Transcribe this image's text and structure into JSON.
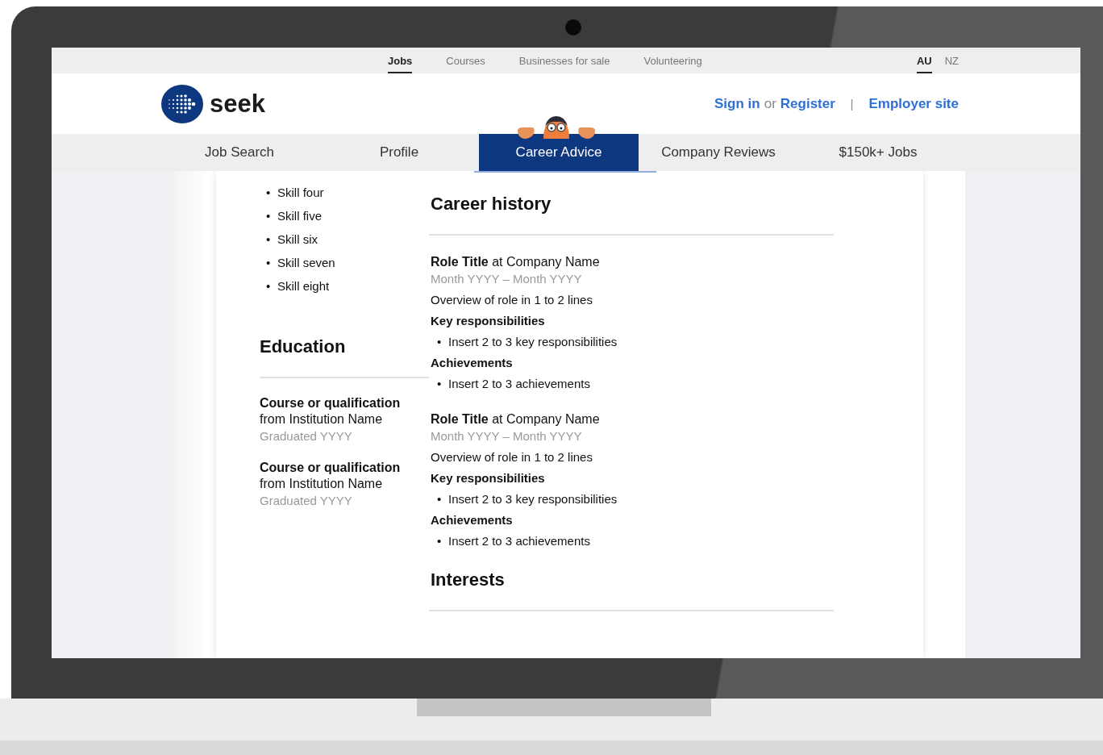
{
  "top_bar": {
    "links": [
      {
        "label": "Jobs",
        "selected": true
      },
      {
        "label": "Courses",
        "selected": false
      },
      {
        "label": "Businesses for sale",
        "selected": false
      },
      {
        "label": "Volunteering",
        "selected": false
      }
    ],
    "regions": [
      {
        "label": "AU",
        "selected": true
      },
      {
        "label": "NZ",
        "selected": false
      }
    ]
  },
  "header": {
    "logo_text": "seek",
    "sign_in": "Sign in",
    "or": "or",
    "register": "Register",
    "separator": "|",
    "employer_site": "Employer site"
  },
  "nav": {
    "tabs": [
      {
        "label": "Job Search",
        "selected": false
      },
      {
        "label": "Profile",
        "selected": false
      },
      {
        "label": "Career Advice",
        "selected": true
      },
      {
        "label": "Company Reviews",
        "selected": false
      },
      {
        "label": "$150k+ Jobs",
        "selected": false
      }
    ]
  },
  "resume": {
    "skills": [
      {
        "marker": "•",
        "text": "Skill four"
      },
      {
        "marker": "•",
        "text": "Skill five"
      },
      {
        "marker": "•",
        "text": "Skill six"
      },
      {
        "marker": "•",
        "text": "Skill seven"
      },
      {
        "marker": "•",
        "text": "Skill eight"
      }
    ],
    "education": {
      "heading": "Education",
      "entries": [
        {
          "course": "Course or qualification",
          "institution": "from Institution Name",
          "graduated": "Graduated YYYY"
        },
        {
          "course": "Course or qualification",
          "institution": "from Institution Name",
          "graduated": "Graduated YYYY"
        }
      ]
    },
    "career_history": {
      "heading": "Career history",
      "roles": [
        {
          "title": "**Role Title** at Company Name",
          "dates": "Month YYYY – Month YYYY",
          "overview": "Overview of role in 1 to 2 lines",
          "responsibilities_heading": "Key responsibilities",
          "responsibilities": [
            {
              "marker": "•",
              "text": "Insert 2 to 3 key responsibilities"
            }
          ],
          "achievements_heading": "Achievements",
          "achievements": [
            {
              "marker": "•",
              "text": "Insert 2 to 3 achievements"
            }
          ]
        },
        {
          "title": "**Role Title** at Company Name",
          "dates": "Month YYYY – Month YYYY",
          "overview": "Overview of role in 1 to 2 lines",
          "responsibilities_heading": "Key responsibilities",
          "responsibilities": [
            {
              "marker": "•",
              "text": "Insert 2 to 3 key responsibilities"
            }
          ],
          "achievements_heading": "Achievements",
          "achievements": [
            {
              "marker": "•",
              "text": "Insert 2 to 3 achievements"
            }
          ]
        }
      ]
    },
    "interests": {
      "heading": "Interests"
    }
  }
}
